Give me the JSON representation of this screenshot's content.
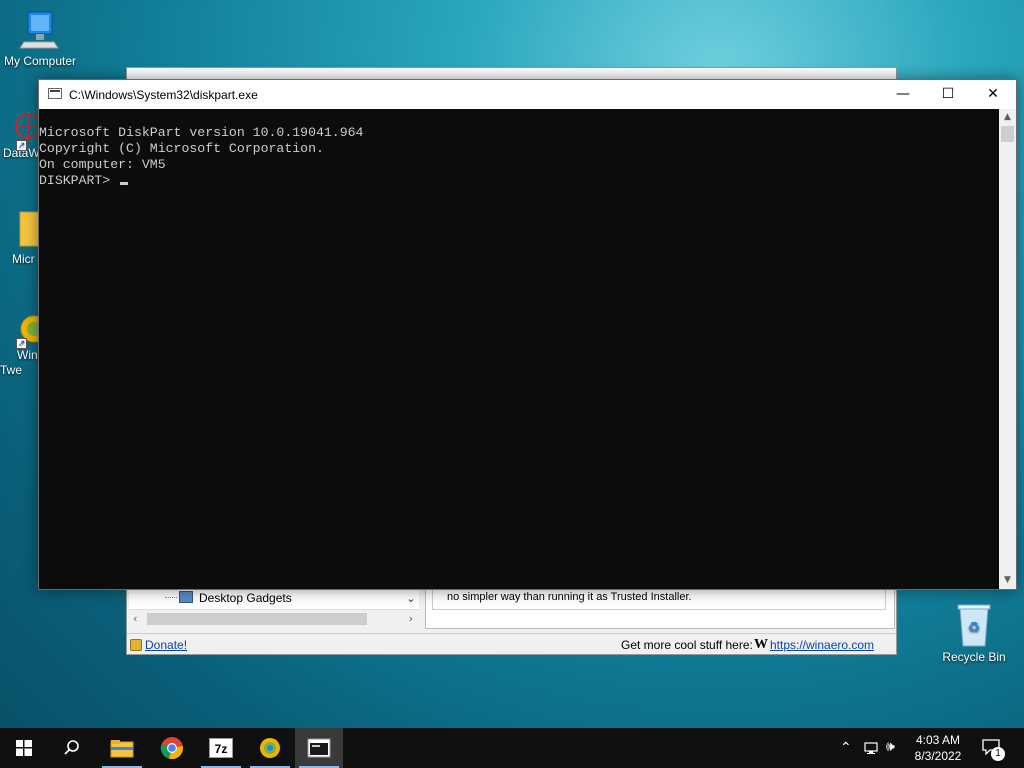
{
  "desktop": {
    "icons": [
      {
        "label": "My Computer"
      },
      {
        "label": "DataW"
      },
      {
        "label": "Micr"
      },
      {
        "label": "Win\nTwe"
      },
      {
        "label": "Recycle Bin"
      }
    ]
  },
  "background_window": {
    "tree_item": "Desktop Gadgets",
    "description_text": "no simpler way than running it as Trusted Installer.",
    "donate_link": "Donate!",
    "more_stuff_label": "Get more cool stuff here:",
    "winaero_logo": "W",
    "winaero_link": "https://winaero.com"
  },
  "console": {
    "title": "C:\\Windows\\System32\\diskpart.exe",
    "minimize_glyph": "—",
    "maximize_glyph": "☐",
    "close_glyph": "✕",
    "lines": [
      "Microsoft DiskPart version 10.0.19041.964",
      "",
      "Copyright (C) Microsoft Corporation.",
      "On computer: VM5",
      "",
      "DISKPART> "
    ]
  },
  "taskbar": {
    "items": [
      {
        "name": "start",
        "icon": "windows-logo-icon"
      },
      {
        "name": "search",
        "icon": "search-icon"
      },
      {
        "name": "file-explorer",
        "icon": "folder-icon"
      },
      {
        "name": "chrome",
        "icon": "chrome-icon"
      },
      {
        "name": "7zip",
        "icon": "7zip-icon",
        "label": "7z"
      },
      {
        "name": "winaero-tweaker",
        "icon": "winaero-icon"
      },
      {
        "name": "console",
        "icon": "console-icon",
        "active": true
      }
    ],
    "tray": {
      "time": "4:03 AM",
      "date": "8/3/2022",
      "notification_count": "1"
    }
  },
  "colors": {
    "console_bg": "#0c0c0c",
    "console_text": "#cccccc",
    "taskbar_bg": "#101010",
    "link": "#0645ad"
  }
}
